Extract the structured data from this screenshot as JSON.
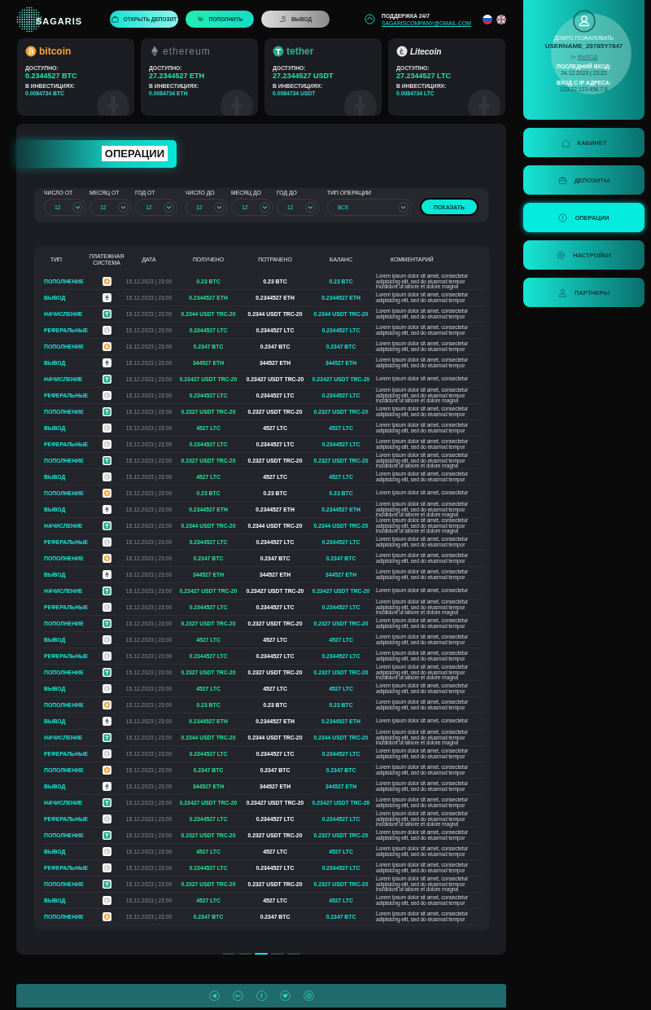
{
  "header": {
    "logo": "SAGARIS",
    "buttons": [
      {
        "label": "ОТКРЫТЬ ДЕПОЗИТ",
        "kind": "deposit"
      },
      {
        "label": "ПОПОЛНИТЬ",
        "kind": "topup"
      },
      {
        "label": "ВЫВОД",
        "kind": "withdraw"
      }
    ],
    "support": {
      "label": "ПОДДЕРЖКА 24/7",
      "email": "SAGARISCOMPANY@GMAIL.COM"
    }
  },
  "wallets": [
    {
      "kind": "btc",
      "name": "bitcoin",
      "available_label": "ДОСТУПНО:",
      "available": "0.2344527 BTC",
      "invested_label": "В ИНВЕСТИЦИЯХ:",
      "invested": "0.0084734 BTC"
    },
    {
      "kind": "eth",
      "name": "ethereum",
      "available_label": "ДОСТУПНО:",
      "available": "27.2344527 ETH",
      "invested_label": "В ИНВЕСТИЦИЯХ:",
      "invested": "0.0084734 ETH"
    },
    {
      "kind": "usdt",
      "name": "tether",
      "available_label": "ДОСТУПНО:",
      "available": "27.2344527 USDT",
      "invested_label": "В ИНВЕСТИЦИЯХ:",
      "invested": "0.0084734 USDT"
    },
    {
      "kind": "ltc",
      "name": "Litecoin",
      "available_label": "ДОСТУПНО:",
      "available": "27.2344527 LTC",
      "invested_label": "В ИНВЕСТИЦИЯХ:",
      "invested": "0.0084734 LTC"
    }
  ],
  "profile": {
    "greeting": "ДОБРО ПОЖАЛОВАТЬ",
    "username": "USERNAME_29785Y7847",
    "logout": "ВЫХОД",
    "last_login_label": "ПОСЛЕДНИЙ ВХОД:",
    "last_login": "24.12.2023 | 23:22",
    "ip_label": "ВХОД С IP АДРЕСА:",
    "ip": "123.22.123.456.7.8"
  },
  "nav": [
    {
      "label": "КАБИНЕТ",
      "selected": false
    },
    {
      "label": "ДЕПОЗИТЫ",
      "selected": false
    },
    {
      "label": "ОПЕРАЦИИ",
      "selected": true
    },
    {
      "label": "НАСТРОЙКИ",
      "selected": false
    },
    {
      "label": "ПАРТНЕРЫ",
      "selected": false
    }
  ],
  "title": "ОПЕРАЦИИ",
  "filters": [
    {
      "label": "ЧИСЛО ОТ",
      "value": "12"
    },
    {
      "label": "МЕСЯЦ ОТ",
      "value": "12"
    },
    {
      "label": "ГОД ОТ",
      "value": "12"
    },
    {
      "label": "ЧИСЛО ДО",
      "value": "12"
    },
    {
      "label": "МЕСЯЦ ДО",
      "value": "12"
    },
    {
      "label": "ГОД ДО",
      "value": "12"
    },
    {
      "label": "ТИП ОПЕРАЦИИ",
      "value": "ВСЕ"
    }
  ],
  "show_button": "ПОКАЗАТЬ",
  "table": {
    "columns": [
      "ТИП",
      "ПЛАТЕЖНАЯ\nСИСТЕМА",
      "ДАТА",
      "ПОЛУЧЕНО",
      "ПОТРАЧЕНО",
      "БАЛАНС",
      "КОММЕНТАРИЙ"
    ],
    "rows": [
      {
        "type": "ПОПОЛНЕНИЕ",
        "kind": "btc",
        "date": "15.12.2023 | 23:00",
        "received": "0.23 BTC",
        "spent": "0.23 BTC",
        "balance": "0.23 BTC",
        "comment": "Lorem ipsum dolor sit amet, consectetur\nadipisicing elit, sed do eiusmod tempor\nincididunt ut labore et dolore magna"
      },
      {
        "type": "ВЫВОД",
        "kind": "eth",
        "date": "15.12.2023 | 23:00",
        "received": "0.2344527 ETH",
        "spent": "0.2344527 ETH",
        "balance": "0.2344527 ETH",
        "comment": "Lorem ipsum dolor sit amet, consectetur\nadipisicing elit, sed do eiusmod tempor"
      },
      {
        "type": "НАЧИСЛЕНИЕ",
        "kind": "usdt",
        "date": "15.12.2023 | 23:00",
        "received": "0.2344 USDT TRC-20",
        "spent": "0.2344 USDT TRC-20",
        "balance": "0.2344 USDT TRC-20",
        "comment": "Lorem ipsum dolor sit amet, consectetur\nadipisicing elit, sed do eiusmod tempor"
      },
      {
        "type": "РЕФЕРАЛЬНЫЕ",
        "kind": "ltc",
        "date": "15.12.2023 | 23:00",
        "received": "0.2344527 LTC",
        "spent": "0.2344527 LTC",
        "balance": "0.2344527 LTC",
        "comment": "Lorem ipsum dolor sit amet, consectetur\nadipisicing elit, sed do eiusmod tempor"
      },
      {
        "type": "ПОПОЛНЕНИЕ",
        "kind": "btc",
        "date": "15.12.2023 | 23:00",
        "received": "0.2347 BTC",
        "spent": "0.2347 BTC",
        "balance": "0.2347 BTC",
        "comment": "Lorem ipsum dolor sit amet, consectetur\nadipisicing elit, sed do eiusmod tempor"
      },
      {
        "type": "ВЫВОД",
        "kind": "eth",
        "date": "15.12.2023 | 23:00",
        "received": "344527 ETH",
        "spent": "344527 ETH",
        "balance": "344527 ETH",
        "comment": "Lorem ipsum dolor sit amet, consectetur\nadipisicing elit, sed do eiusmod tempor"
      },
      {
        "type": "НАЧИСЛЕНИЕ",
        "kind": "usdt",
        "date": "15.12.2023 | 23:00",
        "received": "0.23427 USDT TRC-20",
        "spent": "0.23427 USDT TRC-20",
        "balance": "0.23427 USDT TRC-20",
        "comment": "Lorem ipsum dolor sit amet, consectetur"
      },
      {
        "type": "РЕФЕРАЛЬНЫЕ",
        "kind": "ltc",
        "date": "15.12.2023 | 23:00",
        "received": "0.2344527 LTC",
        "spent": "0.2344527 LTC",
        "balance": "0.2344527 LTC",
        "comment": "Lorem ipsum dolor sit amet, consectetur\nadipisicing elit, sed do eiusmod tempor\nincididunt ut labore et dolore magna"
      },
      {
        "type": "ПОПОЛНЕНИЕ",
        "kind": "usdt",
        "date": "15.12.2023 | 23:00",
        "received": "0.2327 USDT TRC-20",
        "spent": "0.2327 USDT TRC-20",
        "balance": "0.2327 USDT TRC-20",
        "comment": "Lorem ipsum dolor sit amet, consectetur\nadipisicing elit, sed do eiusmod tempor"
      },
      {
        "type": "ВЫВОД",
        "kind": "ltc",
        "date": "15.12.2023 | 23:00",
        "received": "4527 LTC",
        "spent": "4527 LTC",
        "balance": "4527 LTC",
        "comment": "Lorem ipsum dolor sit amet, consectetur\nadipisicing elit, sed do eiusmod tempor"
      },
      {
        "type": "РЕФЕРАЛЬНЫЕ",
        "kind": "ltc",
        "date": "15.12.2023 | 23:00",
        "received": "0.2344527 LTC",
        "spent": "0.2344527 LTC",
        "balance": "0.2344527 LTC",
        "comment": "Lorem ipsum dolor sit amet, consectetur\nadipisicing elit, sed do eiusmod tempor"
      },
      {
        "type": "ПОПОЛНЕНИЕ",
        "kind": "usdt",
        "date": "15.12.2023 | 23:00",
        "received": "0.2327 USDT TRC-20",
        "spent": "0.2327 USDT TRC-20",
        "balance": "0.2327 USDT TRC-20",
        "comment": "Lorem ipsum dolor sit amet, consectetur\nadipisicing elit, sed do eiusmod tempor\nincididunt ut labore et dolore magna"
      },
      {
        "type": "ВЫВОД",
        "kind": "ltc",
        "date": "15.12.2023 | 23:00",
        "received": "4527 LTC",
        "spent": "4527 LTC",
        "balance": "4527 LTC",
        "comment": "Lorem ipsum dolor sit amet, consectetur\nadipisicing elit, sed do eiusmod tempor"
      },
      {
        "type": "ПОПОЛНЕНИЕ",
        "kind": "btc",
        "date": "15.12.2023 | 23:00",
        "received": "0.23 BTC",
        "spent": "0.23 BTC",
        "balance": "0.23 BTC",
        "comment": "Lorem ipsum dolor sit amet, consectetur"
      },
      {
        "type": "ВЫВОД",
        "kind": "eth",
        "date": "15.12.2023 | 23:00",
        "received": "0.2344527 ETH",
        "spent": "0.2344527 ETH",
        "balance": "0.2344527 ETH",
        "comment": "Lorem ipsum dolor sit amet, consectetur\nadipisicing elit, sed do eiusmod tempor\nincididunt ut labore et dolore magna"
      },
      {
        "type": "НАЧИСЛЕНИЕ",
        "kind": "usdt",
        "date": "15.12.2023 | 23:00",
        "received": "0.2344 USDT TRC-20",
        "spent": "0.2344 USDT TRC-20",
        "balance": "0.2344 USDT TRC-20",
        "comment": "Lorem ipsum dolor sit amet, consectetur\nadipisicing elit, sed do eiusmod tempor\nincididunt ut labore et dolore magna"
      },
      {
        "type": "РЕФЕРАЛЬНЫЕ",
        "kind": "ltc",
        "date": "15.12.2023 | 23:00",
        "received": "0.2344527 LTC",
        "spent": "0.2344527 LTC",
        "balance": "0.2344527 LTC",
        "comment": "Lorem ipsum dolor sit amet, consectetur\nadipisicing elit, sed do eiusmod tempor"
      },
      {
        "type": "ПОПОЛНЕНИЕ",
        "kind": "btc",
        "date": "15.12.2023 | 23:00",
        "received": "0.2347 BTC",
        "spent": "0.2347 BTC",
        "balance": "0.2347 BTC",
        "comment": "Lorem ipsum dolor sit amet, consectetur\nadipisicing elit, sed do eiusmod tempor"
      },
      {
        "type": "ВЫВОД",
        "kind": "eth",
        "date": "15.12.2023 | 23:00",
        "received": "344527 ETH",
        "spent": "344527 ETH",
        "balance": "344527 ETH",
        "comment": "Lorem ipsum dolor sit amet, consectetur\nadipisicing elit, sed do eiusmod tempor"
      },
      {
        "type": "НАЧИСЛЕНИЕ",
        "kind": "usdt",
        "date": "15.12.2023 | 23:00",
        "received": "0.23427 USDT TRC-20",
        "spent": "0.23427 USDT TRC-20",
        "balance": "0.23427 USDT TRC-20",
        "comment": "Lorem ipsum dolor sit amet, consectetur"
      },
      {
        "type": "РЕФЕРАЛЬНЫЕ",
        "kind": "ltc",
        "date": "15.12.2023 | 23:00",
        "received": "0.2344527 LTC",
        "spent": "0.2344527 LTC",
        "balance": "0.2344527 LTC",
        "comment": "Lorem ipsum dolor sit amet, consectetur\nadipisicing elit, sed do eiusmod tempor\nincididunt ut labore et dolore magna"
      },
      {
        "type": "ПОПОЛНЕНИЕ",
        "kind": "usdt",
        "date": "15.12.2023 | 23:00",
        "received": "0.2327 USDT TRC-20",
        "spent": "0.2327 USDT TRC-20",
        "balance": "0.2327 USDT TRC-20",
        "comment": "Lorem ipsum dolor sit amet, consectetur\nadipisicing elit, sed do eiusmod tempor"
      },
      {
        "type": "ВЫВОД",
        "kind": "ltc",
        "date": "15.12.2023 | 23:00",
        "received": "4527 LTC",
        "spent": "4527 LTC",
        "balance": "4527 LTC",
        "comment": "Lorem ipsum dolor sit amet, consectetur\nadipisicing elit, sed do eiusmod tempor"
      },
      {
        "type": "РЕФЕРАЛЬНЫЕ",
        "kind": "ltc",
        "date": "15.12.2023 | 23:00",
        "received": "0.2344527 LTC",
        "spent": "0.2344527 LTC",
        "balance": "0.2344527 LTC",
        "comment": "Lorem ipsum dolor sit amet, consectetur\nadipisicing elit, sed do eiusmod tempor"
      },
      {
        "type": "ПОПОЛНЕНИЕ",
        "kind": "usdt",
        "date": "15.12.2023 | 23:00",
        "received": "0.2327 USDT TRC-20",
        "spent": "0.2327 USDT TRC-20",
        "balance": "0.2327 USDT TRC-20",
        "comment": "Lorem ipsum dolor sit amet, consectetur\nadipisicing elit, sed do eiusmod tempor\nincididunt ut labore et dolore magna"
      },
      {
        "type": "ВЫВОД",
        "kind": "ltc",
        "date": "15.12.2023 | 23:00",
        "received": "4527 LTC",
        "spent": "4527 LTC",
        "balance": "4527 LTC",
        "comment": "Lorem ipsum dolor sit amet, consectetur\nadipisicing elit, sed do eiusmod tempor"
      },
      {
        "type": "ПОПОЛНЕНИЕ",
        "kind": "btc",
        "date": "15.12.2023 | 23:00",
        "received": "0.23 BTC",
        "spent": "0.23 BTC",
        "balance": "0.23 BTC",
        "comment": "Lorem ipsum dolor sit amet, consectetur\nadipisicing elit, sed do eiusmod tempor"
      },
      {
        "type": "ВЫВОД",
        "kind": "eth",
        "date": "15.12.2023 | 23:00",
        "received": "0.2344527 ETH",
        "spent": "0.2344527 ETH",
        "balance": "0.2344527 ETH",
        "comment": "Lorem ipsum dolor sit amet, consectetur"
      },
      {
        "type": "НАЧИСЛЕНИЕ",
        "kind": "usdt",
        "date": "15.12.2023 | 23:00",
        "received": "0.2344 USDT TRC-20",
        "spent": "0.2344 USDT TRC-20",
        "balance": "0.2344 USDT TRC-20",
        "comment": "Lorem ipsum dolor sit amet, consectetur\nadipisicing elit, sed do eiusmod tempor\nincididunt ut labore et dolore magna"
      },
      {
        "type": "РЕФЕРАЛЬНЫЕ",
        "kind": "ltc",
        "date": "15.12.2023 | 23:00",
        "received": "0.2344527 LTC",
        "spent": "0.2344527 LTC",
        "balance": "0.2344527 LTC",
        "comment": "Lorem ipsum dolor sit amet, consectetur\nadipisicing elit, sed do eiusmod tempor"
      },
      {
        "type": "ПОПОЛНЕНИЕ",
        "kind": "btc",
        "date": "15.12.2023 | 23:00",
        "received": "0.2347 BTC",
        "spent": "0.2347 BTC",
        "balance": "0.2347 BTC",
        "comment": "Lorem ipsum dolor sit amet, consectetur\nadipisicing elit, sed do eiusmod tempor"
      },
      {
        "type": "ВЫВОД",
        "kind": "eth",
        "date": "15.12.2023 | 23:00",
        "received": "344527 ETH",
        "spent": "344527 ETH",
        "balance": "344527 ETH",
        "comment": "Lorem ipsum dolor sit amet, consectetur\nadipisicing elit, sed do eiusmod tempor"
      },
      {
        "type": "НАЧИСЛЕНИЕ",
        "kind": "usdt",
        "date": "15.12.2023 | 23:00",
        "received": "0.23427 USDT TRC-20",
        "spent": "0.23427 USDT TRC-20",
        "balance": "0.23427 USDT TRC-20",
        "comment": "Lorem ipsum dolor sit amet, consectetur\nadipisicing elit, sed do eiusmod tempor"
      },
      {
        "type": "РЕФЕРАЛЬНЫЕ",
        "kind": "ltc",
        "date": "15.12.2023 | 23:00",
        "received": "0.2344527 LTC",
        "spent": "0.2344527 LTC",
        "balance": "0.2344527 LTC",
        "comment": "Lorem ipsum dolor sit amet, consectetur\nadipisicing elit, sed do eiusmod tempor\nincididunt ut labore et dolore magna"
      },
      {
        "type": "ПОПОЛНЕНИЕ",
        "kind": "usdt",
        "date": "15.12.2023 | 23:00",
        "received": "0.2327 USDT TRC-20",
        "spent": "0.2327 USDT TRC-20",
        "balance": "0.2327 USDT TRC-20",
        "comment": "Lorem ipsum dolor sit amet, consectetur\nadipisicing elit, sed do eiusmod tempor"
      },
      {
        "type": "ВЫВОД",
        "kind": "ltc",
        "date": "15.12.2023 | 23:00",
        "received": "4527 LTC",
        "spent": "4527 LTC",
        "balance": "4527 LTC",
        "comment": "Lorem ipsum dolor sit amet, consectetur\nadipisicing elit, sed do eiusmod tempor"
      },
      {
        "type": "РЕФЕРАЛЬНЫЕ",
        "kind": "ltc",
        "date": "15.12.2023 | 23:00",
        "received": "0.2344527 LTC",
        "spent": "0.2344527 LTC",
        "balance": "0.2344527 LTC",
        "comment": "Lorem ipsum dolor sit amet, consectetur\nadipisicing elit, sed do eiusmod tempor"
      },
      {
        "type": "ПОПОЛНЕНИЕ",
        "kind": "usdt",
        "date": "15.12.2023 | 23:00",
        "received": "0.2327 USDT TRC-20",
        "spent": "0.2327 USDT TRC-20",
        "balance": "0.2327 USDT TRC-20",
        "comment": "Lorem ipsum dolor sit amet, consectetur\nadipisicing elit, sed do eiusmod tempor\nincididunt ut labore et dolore magna"
      },
      {
        "type": "ВЫВОД",
        "kind": "ltc",
        "date": "15.12.2023 | 23:00",
        "received": "4527 LTC",
        "spent": "4527 LTC",
        "balance": "4527 LTC",
        "comment": "Lorem ipsum dolor sit amet, consectetur\nadipisicing elit, sed do eiusmod tempor"
      },
      {
        "type": "ПОПОЛНЕНИЕ",
        "kind": "btc",
        "date": "15.12.2023 | 23:00",
        "received": "0.2347 BTC",
        "spent": "0.2347 BTC",
        "balance": "0.2347 BTC",
        "comment": "Lorem ipsum dolor sit amet, consectetur\nadipisicing elit, sed do eiusmod tempor"
      }
    ]
  },
  "pagination": [
    {
      "selected": false
    },
    {
      "selected": false
    },
    {
      "selected": true
    },
    {
      "selected": false
    },
    {
      "selected": false
    }
  ]
}
